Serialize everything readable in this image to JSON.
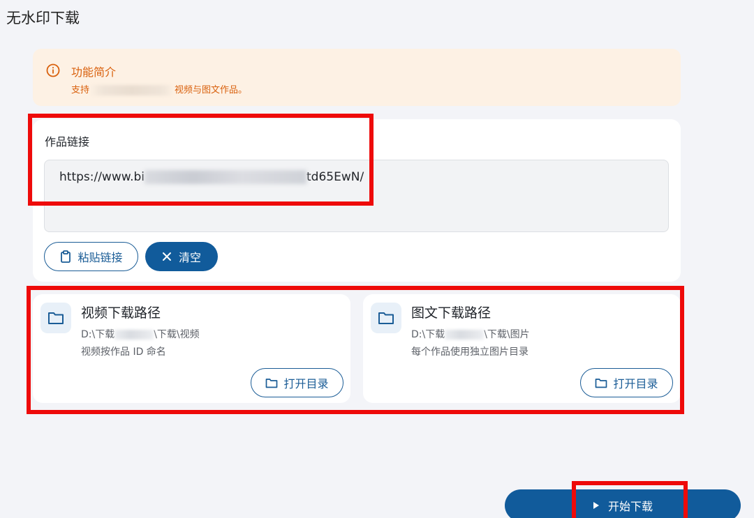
{
  "page": {
    "title": "无水印下载"
  },
  "info": {
    "title": "功能简介",
    "desc_prefix": "支持",
    "desc_suffix": "视频与图文作品。"
  },
  "link": {
    "label": "作品链接",
    "value_prefix": "https://www.bi",
    "value_suffix": "td65EwN/"
  },
  "buttons": {
    "paste": "粘贴链接",
    "clear": "清空",
    "start": "开始下载"
  },
  "video_path": {
    "title": "视频下载路径",
    "dir_prefix": "D:\\下载",
    "dir_suffix": "\\下载\\视频",
    "note": "视频按作品 ID 命名",
    "open": "打开目录"
  },
  "image_path": {
    "title": "图文下载路径",
    "dir_prefix": "D:\\下载",
    "dir_suffix": "\\下载\\图片",
    "note": "每个作品使用独立图片目录",
    "open": "打开目录"
  },
  "colors": {
    "primary": "#115b9b",
    "info_text": "#d9600c",
    "info_bg": "#fdf1e4",
    "annotation": "#ee0a0a"
  },
  "icons": {
    "info": "info-circle-icon",
    "clipboard": "clipboard-icon",
    "close": "close-icon",
    "folder": "folder-icon",
    "play": "play-icon"
  }
}
